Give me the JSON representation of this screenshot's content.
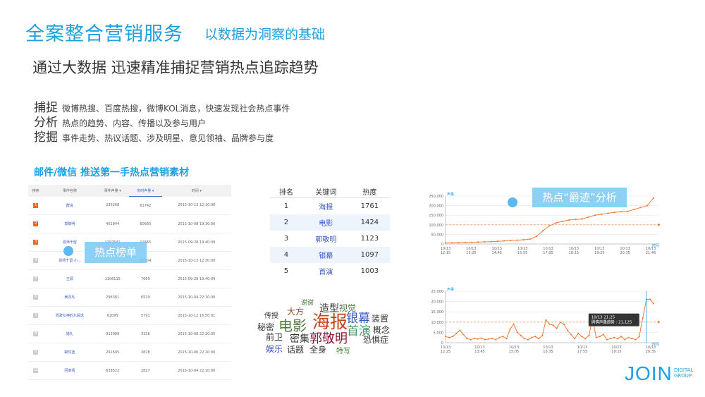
{
  "header": {
    "title": "全案整合营销服务",
    "subtitle": "以数据为洞察的基础",
    "headline": "通过大数据 迅速精准捕捉营销热点追踪趋势"
  },
  "bullets": [
    {
      "keyword": "捕捉",
      "text": "微博热搜、百度热搜，微博KOL消息，快速发现社会热点事件"
    },
    {
      "keyword": "分析",
      "text": "热点的趋势、内容、传播以及参与用户"
    },
    {
      "keyword": "挖掘",
      "text": "事件走势、热议话题、涉及明星、意见领袖、品牌参与度"
    }
  ],
  "section_label": "邮件/微信 推送第一手热点营销素材",
  "ranking": {
    "overlay": "热点榜单",
    "headers": [
      "排序",
      "事件名称",
      "事件声量 ▾",
      "实时声量 ▾",
      "时间 ▾"
    ],
    "rows": [
      {
        "rank": "1",
        "name": "群说",
        "total": "236268",
        "live": "61742",
        "time": "2015-10-13 12:10:00"
      },
      {
        "rank": "2",
        "name": "郭敬明",
        "total": "401844",
        "live": "60685",
        "time": "2015-10-08 19:30:00"
      },
      {
        "rank": "3",
        "name": "恩师千留",
        "total": "1297641",
        "live": "11845",
        "time": "2015-09-28 19:40:09"
      },
      {
        "rank": "4",
        "name": "恩师千留·小...",
        "total": "",
        "live": "10604",
        "time": "2015-10-13 12:30:00"
      },
      {
        "rank": "5",
        "name": "王源",
        "total": "1106115",
        "live": "7669",
        "time": "2015-09-28 19:40:09"
      },
      {
        "rank": "6",
        "name": "吴亦凡",
        "total": "296381",
        "live": "6529",
        "time": "2015-10-04 22:10:00"
      },
      {
        "rank": "7",
        "name": "驾驶女神的九段选",
        "total": "62095",
        "live": "5791",
        "time": "2015-10-12 16:50:01"
      },
      {
        "rank": "8",
        "name": "婚礼",
        "total": "913089",
        "live": "3156",
        "time": "2015-10-08 22:20:00"
      },
      {
        "rank": "9",
        "name": "邮件篮",
        "total": "291695",
        "live": "2828",
        "time": "2015-10-06 22:20:00"
      },
      {
        "rank": "10",
        "name": "回家情",
        "total": "638522",
        "live": "2827",
        "time": "2015-10-04 22:10:00"
      }
    ]
  },
  "keywords": {
    "headers": [
      "排名",
      "关键词",
      "热度"
    ],
    "rows": [
      {
        "rank": "1",
        "word": "海报",
        "heat": "1761"
      },
      {
        "rank": "2",
        "word": "电影",
        "heat": "1424"
      },
      {
        "rank": "3",
        "word": "郭敬明",
        "heat": "1123"
      },
      {
        "rank": "4",
        "word": "银幕",
        "heat": "1097"
      },
      {
        "rank": "5",
        "word": "首演",
        "heat": "1003"
      }
    ]
  },
  "word_cloud": [
    {
      "text": "谢谢",
      "color": "#4a7a3a"
    },
    {
      "text": "造型",
      "color": "#333333"
    },
    {
      "text": "视觉",
      "color": "#4a7a3a"
    },
    {
      "text": "大方",
      "color": "#8a4a1a"
    },
    {
      "text": "银幕",
      "color": "#3a58c2"
    },
    {
      "text": "装置",
      "color": "#333333"
    },
    {
      "text": "传授",
      "color": "#333333"
    },
    {
      "text": "电影",
      "color": "#4a7a3a"
    },
    {
      "text": "海报",
      "color": "#c2461a"
    },
    {
      "text": "秘密",
      "color": "#333333"
    },
    {
      "text": "首演",
      "color": "#4a9a6a"
    },
    {
      "text": "概念",
      "color": "#333333"
    },
    {
      "text": "前卫",
      "color": "#333333"
    },
    {
      "text": "密集",
      "color": "#333333"
    },
    {
      "text": "郭敬明",
      "color": "#8a1a3a"
    },
    {
      "text": "恐惧症",
      "color": "#333333"
    },
    {
      "text": "娱乐",
      "color": "#3a58c2"
    },
    {
      "text": "话题",
      "color": "#333333"
    },
    {
      "text": "全身",
      "color": "#333333"
    },
    {
      "text": "特写",
      "color": "#4a7a3a"
    }
  ],
  "trace_overlay": "热点“爵迹”分析",
  "chart_data": [
    {
      "type": "line",
      "ylabel": "声量",
      "xlabel": "时间",
      "ylim": [
        0,
        250000
      ],
      "yticks": [
        "250,000",
        "200,000",
        "150,000",
        "100,000",
        "50,000",
        "0"
      ],
      "xticks": [
        "10/13 12:15",
        "10/13 13:25",
        "10/13 14:45",
        "10/13 15:55",
        "10/13 17:05",
        "10/13 18:15",
        "10/13 19:25",
        "10/13 20:35",
        "10/13 21:46"
      ],
      "reference": 100000,
      "series": [
        {
          "values": [
            5000,
            6000,
            7000,
            8000,
            9000,
            10000,
            11000,
            12000,
            14000,
            16000,
            18000,
            20000,
            22000,
            25000,
            40000,
            70000,
            95000,
            110000,
            118000,
            125000,
            128000,
            130000,
            140000,
            150000,
            155000,
            160000,
            165000,
            168000,
            170000,
            180000,
            190000,
            200000,
            240000
          ]
        }
      ],
      "color": "#f07c3a"
    },
    {
      "type": "line",
      "ylabel": "声量",
      "xlabel": "时间",
      "ylim": [
        0,
        25000
      ],
      "yticks": [
        "25,000",
        "20,000",
        "15,000",
        "10,000",
        "5,000",
        "0"
      ],
      "xticks": [
        "10/13 12:25",
        "10/13 13:45",
        "10/13 15:05",
        "10/13 16:35",
        "10/13 17:55",
        "10/13 19:15",
        "10/13 20:35"
      ],
      "reference": 10000,
      "tooltip": {
        "time": "10/13 21:25",
        "label": "舆情声量趋势 : 21,125"
      },
      "series": [
        {
          "values": [
            3000,
            2500,
            3000,
            4500,
            6000,
            4000,
            2000,
            1500,
            2000,
            1800,
            2200,
            1500,
            1800,
            2000,
            1500,
            2500,
            3000,
            2000,
            6500,
            9000,
            5000,
            3500,
            2000,
            1500,
            2500,
            3000,
            2000,
            3500,
            11000,
            9000,
            8500,
            7000,
            10000,
            9000,
            6000,
            4000,
            2000,
            4500,
            3000,
            2000,
            3500,
            12000,
            2500,
            3000,
            4000,
            1500,
            2000,
            2500,
            2000,
            3000,
            1500,
            2500,
            2000,
            1500,
            3000,
            12000,
            21000,
            21125,
            19000
          ]
        }
      ],
      "color": "#f07c3a"
    }
  ],
  "logo": {
    "main": "JOIN",
    "side_line1": "DIGITAL",
    "side_line2": "GROUP"
  }
}
